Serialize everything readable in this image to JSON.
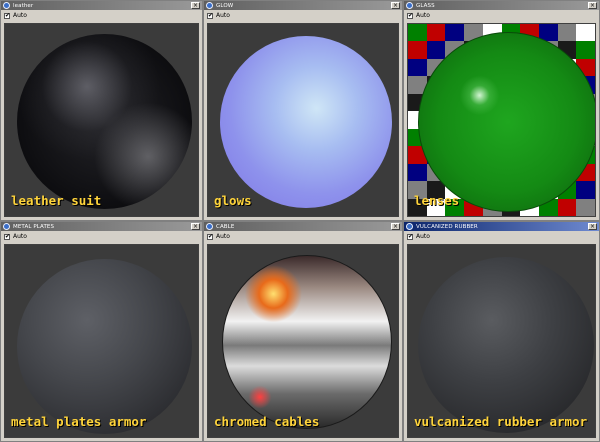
{
  "windows": [
    {
      "title": "leather",
      "checkbox_label": "Auto",
      "caption": "leather suit"
    },
    {
      "title": "GLOW",
      "checkbox_label": "Auto",
      "caption": "glows"
    },
    {
      "title": "GLASS",
      "checkbox_label": "Auto",
      "caption": "lenses"
    },
    {
      "title": "METAL PLATES",
      "checkbox_label": "Auto",
      "caption": "metal plates armor"
    },
    {
      "title": "CABLE",
      "checkbox_label": "Auto",
      "caption": "chromed cables"
    },
    {
      "title": "VULCANIZED RUBBER",
      "checkbox_label": "Auto",
      "caption": "vulcanized rubber armor"
    }
  ],
  "colors": {
    "caption": "#ffd43b",
    "viewport_bg": "#3b3b3b",
    "checker": [
      "#008000",
      "#c00000",
      "#000080",
      "#808080",
      "#1a1a1a",
      "#ffffff"
    ]
  },
  "icons": {
    "window_icon": "app-icon",
    "close": "close-icon",
    "checkbox": "checkbox-icon"
  }
}
